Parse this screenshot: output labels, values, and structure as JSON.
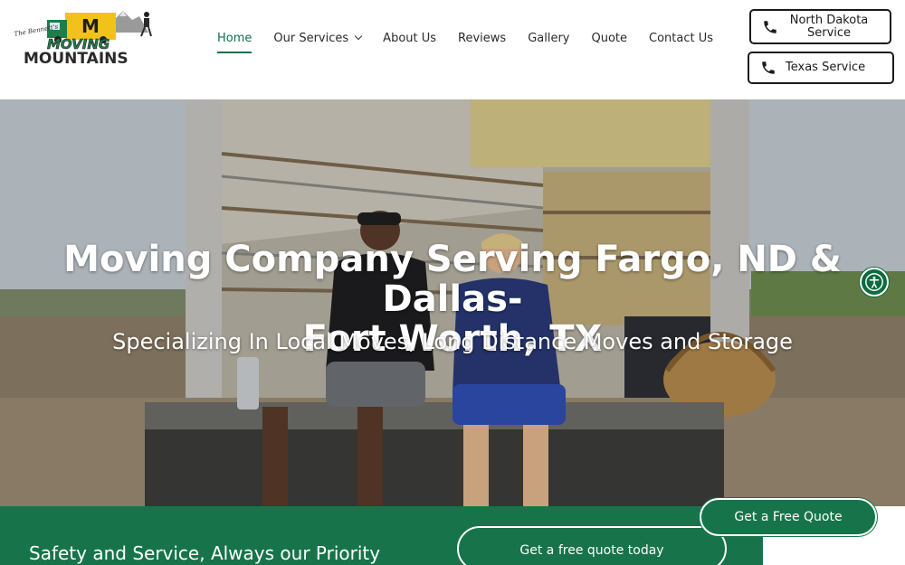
{
  "logo": {
    "script_text": "The Bennett's",
    "line1": "MOVING",
    "line2": "MOUNTAINS",
    "badge": "M"
  },
  "nav": {
    "items": [
      {
        "label": "Home",
        "active": true
      },
      {
        "label": "Our Services",
        "has_dropdown": true
      },
      {
        "label": "About Us"
      },
      {
        "label": "Reviews"
      },
      {
        "label": "Gallery"
      },
      {
        "label": "Quote"
      },
      {
        "label": "Contact Us"
      }
    ]
  },
  "service_buttons": {
    "north_dakota": {
      "line1": "North Dakota",
      "line2": "Service",
      "icon": "phone-icon"
    },
    "texas": {
      "label": "Texas Service",
      "icon": "phone-icon"
    }
  },
  "hero": {
    "title_line1": "Moving Company Serving Fargo, ND & Dallas-",
    "title_line2": "Fort Worth, TX",
    "subtitle": "Specializing In Local Moves, Long Distance Moves and Storage"
  },
  "accessibility": {
    "icon": "accessibility-icon"
  },
  "band": {
    "heading": "Safety and Service, Always our Priority",
    "quote_button": "Get a free quote today"
  },
  "floating_button": {
    "label": "Get a Free Quote"
  },
  "colors": {
    "brand_green": "#17744a",
    "nav_active": "#11704a",
    "text_dark": "#1b1b1b",
    "logo_yellow": "#f2c21b"
  }
}
